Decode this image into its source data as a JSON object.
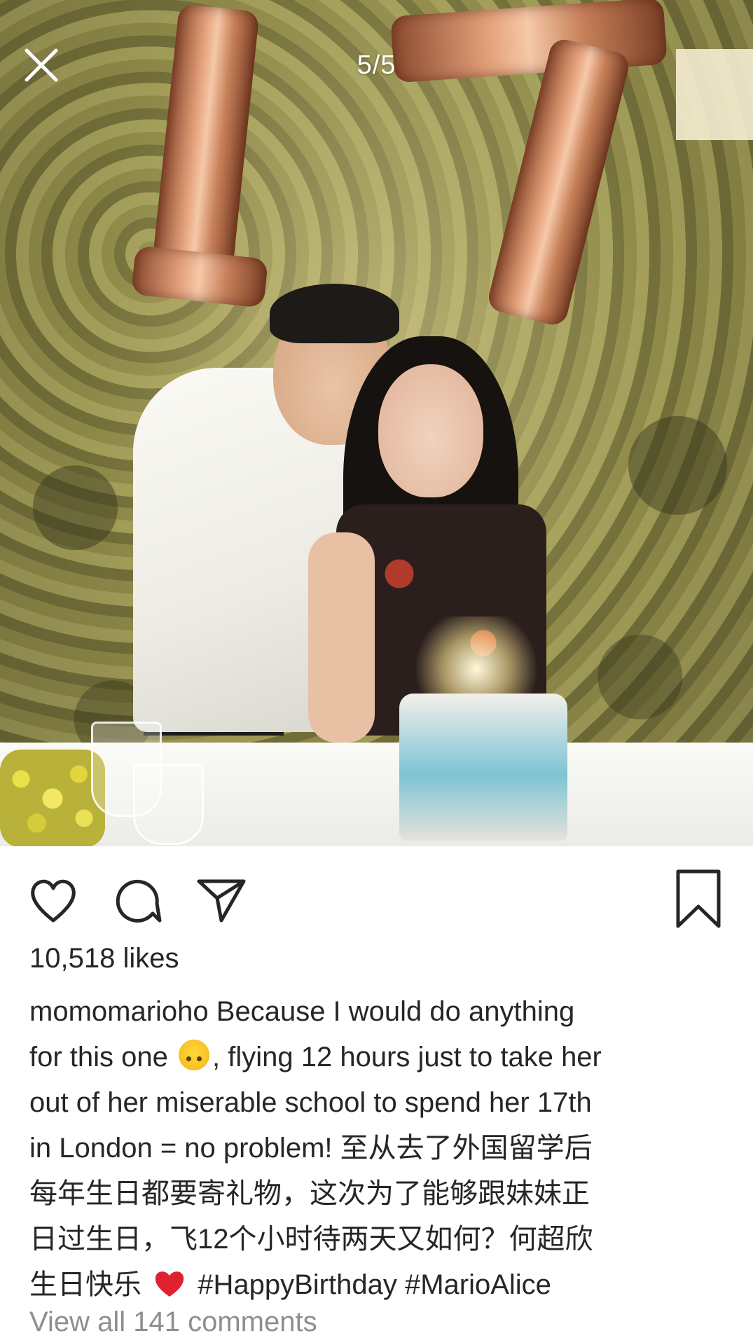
{
  "viewer": {
    "counter": "5/5"
  },
  "post": {
    "likes": "10,518 likes",
    "username": "momomarioho",
    "caption_lines": [
      " Because I would do anything",
      "for this one ",
      ", flying 12 hours just to take her",
      "out of her miserable school to spend her 17th",
      "in London = no problem! 至从去了外国留学后",
      "每年生日都要寄礼物，这次为了能够跟妹妹正",
      "日过生日，飞12个小时待两天又如何？何超欣",
      "生日快乐 ",
      " #HappyBirthday #MarioAlice"
    ],
    "emoji_name": "upside-down-face-emoji",
    "heart_name": "red-heart-emoji",
    "view_comments": "View all 141 comments"
  },
  "colors": {
    "text": "#262626",
    "muted": "#8e8e8e",
    "heart": "#e0212f",
    "background": "#ffffff"
  },
  "icons": [
    "close-icon",
    "heart-icon",
    "comment-icon",
    "share-icon",
    "bookmark-icon"
  ]
}
